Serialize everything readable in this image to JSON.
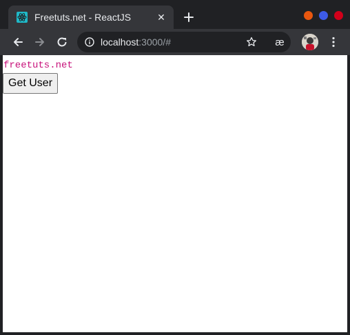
{
  "tab": {
    "title": "Freetuts.net - ReactJS",
    "favicon": "react-icon",
    "close_glyph": "✕",
    "new_tab_icon": "plus-icon"
  },
  "window_controls": {
    "colors": [
      "#e8570f",
      "#3d5be8",
      "#d1001a"
    ]
  },
  "toolbar": {
    "back_icon": "arrow-left-icon",
    "forward_icon": "arrow-right-icon",
    "reload_icon": "reload-icon",
    "url_host": "localhost",
    "url_rest": ":3000/#",
    "bookmark_icon": "star-icon",
    "extension_glyph": "æ",
    "menu_icon": "kebab-menu-icon"
  },
  "page": {
    "brand_text": "freetuts.net",
    "button_label": "Get User"
  },
  "colors": {
    "tab_bg": "#35363a",
    "frame_bg": "#202124",
    "brand_color": "#c7117a"
  }
}
